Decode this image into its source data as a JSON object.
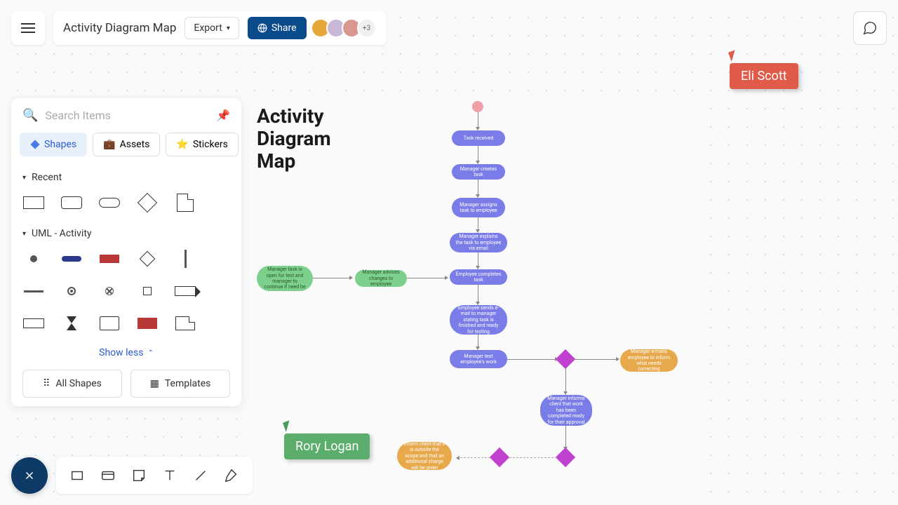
{
  "header": {
    "title": "Activity Diagram Map",
    "export_label": "Export",
    "share_label": "Share",
    "avatar_more": "+3"
  },
  "sidebar": {
    "search_placeholder": "Search Items",
    "tabs": {
      "shapes": "Shapes",
      "assets": "Assets",
      "stickers": "Stickers"
    },
    "sections": {
      "recent": "Recent",
      "uml": "UML - Activity"
    },
    "show_less": "Show less",
    "all_shapes": "All Shapes",
    "templates": "Templates"
  },
  "canvas": {
    "title": "Activity\nDiagram\nMap",
    "nodes": {
      "n1": "Task received",
      "n2": "Manager creates task",
      "n3": "Manager assigns task to employee",
      "n4": "Manager explains the task to employee via email",
      "n5": "Employee completes task",
      "n6": "Employee sends e-mail to manager stating task is finished and ready for testing",
      "n7": "Manager test employee's work",
      "n8": "Manager e-mails employee to inform what needs correcting",
      "n9": "Manager informs client that work has been completed ready for their approval",
      "n10": "Inform client that it is outside the scope and that an additional charge will be given",
      "g1": "Manager task is open for test and manager to continue if need be",
      "g2": "Manager advises changes to employee"
    }
  },
  "cursors": {
    "eli": "Eli Scott",
    "rory": "Rory Logan"
  }
}
